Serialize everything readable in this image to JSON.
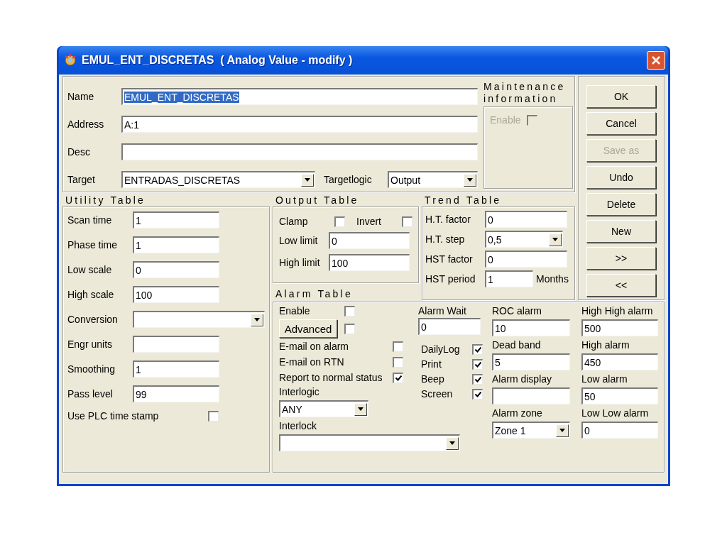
{
  "window": {
    "title": "EMUL_ENT_DISCRETAS  ( Analog Value - modify )"
  },
  "general": {
    "name": {
      "label": "Name",
      "value": "EMUL_ENT_DISCRETAS",
      "text_selected": true
    },
    "address": {
      "label": "Address",
      "value": "A:1"
    },
    "desc": {
      "label": "Desc"
    },
    "target": {
      "label": "Target",
      "value": "ENTRADAS_DISCRETAS"
    },
    "targetlogic": {
      "label": "Targetlogic",
      "value": "Output"
    }
  },
  "maintenance": {
    "title": "Maintenance information",
    "enable": {
      "label": "Enable",
      "checked": false,
      "disabled": true
    }
  },
  "buttons": [
    {
      "label": "OK",
      "disabled": false
    },
    {
      "label": "Cancel",
      "disabled": false
    },
    {
      "label": "Save as",
      "disabled": true
    },
    {
      "label": "Undo",
      "disabled": false
    },
    {
      "label": "Delete",
      "disabled": false
    },
    {
      "label": "New",
      "disabled": false
    },
    {
      "label": ">>",
      "disabled": false
    },
    {
      "label": "<<",
      "disabled": false
    }
  ],
  "utility_table": {
    "title": "Utility Table",
    "rows": [
      {
        "kind": "text",
        "label": "Scan time",
        "value": "1"
      },
      {
        "kind": "text",
        "label": "Phase time",
        "value": "1"
      },
      {
        "kind": "text",
        "label": "Low scale",
        "value": "0"
      },
      {
        "kind": "text",
        "label": "High scale",
        "value": "100"
      },
      {
        "kind": "dropdown",
        "label": "Conversion"
      },
      {
        "kind": "text",
        "label": "Engr units"
      },
      {
        "kind": "text",
        "label": "Smoothing",
        "value": "1"
      },
      {
        "kind": "text",
        "label": "Pass level",
        "value": "99"
      },
      {
        "kind": "checkbox",
        "label": "Use PLC time stamp",
        "checked": false
      }
    ]
  },
  "output_table": {
    "title": "Output Table",
    "clamp": {
      "label": "Clamp",
      "checked": false
    },
    "invert": {
      "label": "Invert",
      "checked": false
    },
    "low_limit": {
      "label": "Low limit",
      "value": "0"
    },
    "high_limit": {
      "label": "High limit",
      "value": "100"
    }
  },
  "trend_table": {
    "title": "Trend Table",
    "rows": [
      {
        "kind": "text",
        "label": "H.T. factor",
        "value": "0"
      },
      {
        "kind": "dropdown",
        "label": "H.T. step",
        "value": "0,5"
      },
      {
        "kind": "text",
        "label": "HST factor",
        "value": "0"
      },
      {
        "kind": "unit",
        "label": "HST period",
        "value": "1",
        "unit": "Months"
      }
    ]
  },
  "alarm_table": {
    "title": "Alarm Table",
    "enable": {
      "label": "Enable",
      "checked": false
    },
    "advanced": {
      "label": "Advanced",
      "checked": false
    },
    "options": [
      {
        "label": "E-mail on alarm",
        "checked": false
      },
      {
        "label": "E-mail on RTN",
        "checked": false
      },
      {
        "label": "Report to normal status",
        "checked": true
      }
    ],
    "interlogic": {
      "label": "Interlogic",
      "value": "ANY"
    },
    "interlock": {
      "label": "Interlock"
    },
    "alarm_wait": {
      "label": "Alarm Wait",
      "value": "0"
    },
    "outputs": [
      {
        "label": "DailyLog",
        "checked": true
      },
      {
        "label": "Print",
        "checked": true
      },
      {
        "label": "Beep",
        "checked": true
      },
      {
        "label": "Screen",
        "checked": true
      }
    ],
    "roc_column": [
      {
        "kind": "text",
        "label": "ROC alarm",
        "value": "10"
      },
      {
        "kind": "text",
        "label": "Dead band",
        "value": "5"
      },
      {
        "kind": "text",
        "label": "Alarm display"
      },
      {
        "kind": "dropdown",
        "label": "Alarm zone",
        "value": "Zone 1"
      }
    ],
    "limits": [
      {
        "kind": "text",
        "label": "High High alarm",
        "value": "500"
      },
      {
        "kind": "text",
        "label": "High alarm",
        "value": "450"
      },
      {
        "kind": "text",
        "label": "Low alarm",
        "value": "50"
      },
      {
        "kind": "text",
        "label": "Low Low alarm",
        "value": "0"
      }
    ]
  }
}
